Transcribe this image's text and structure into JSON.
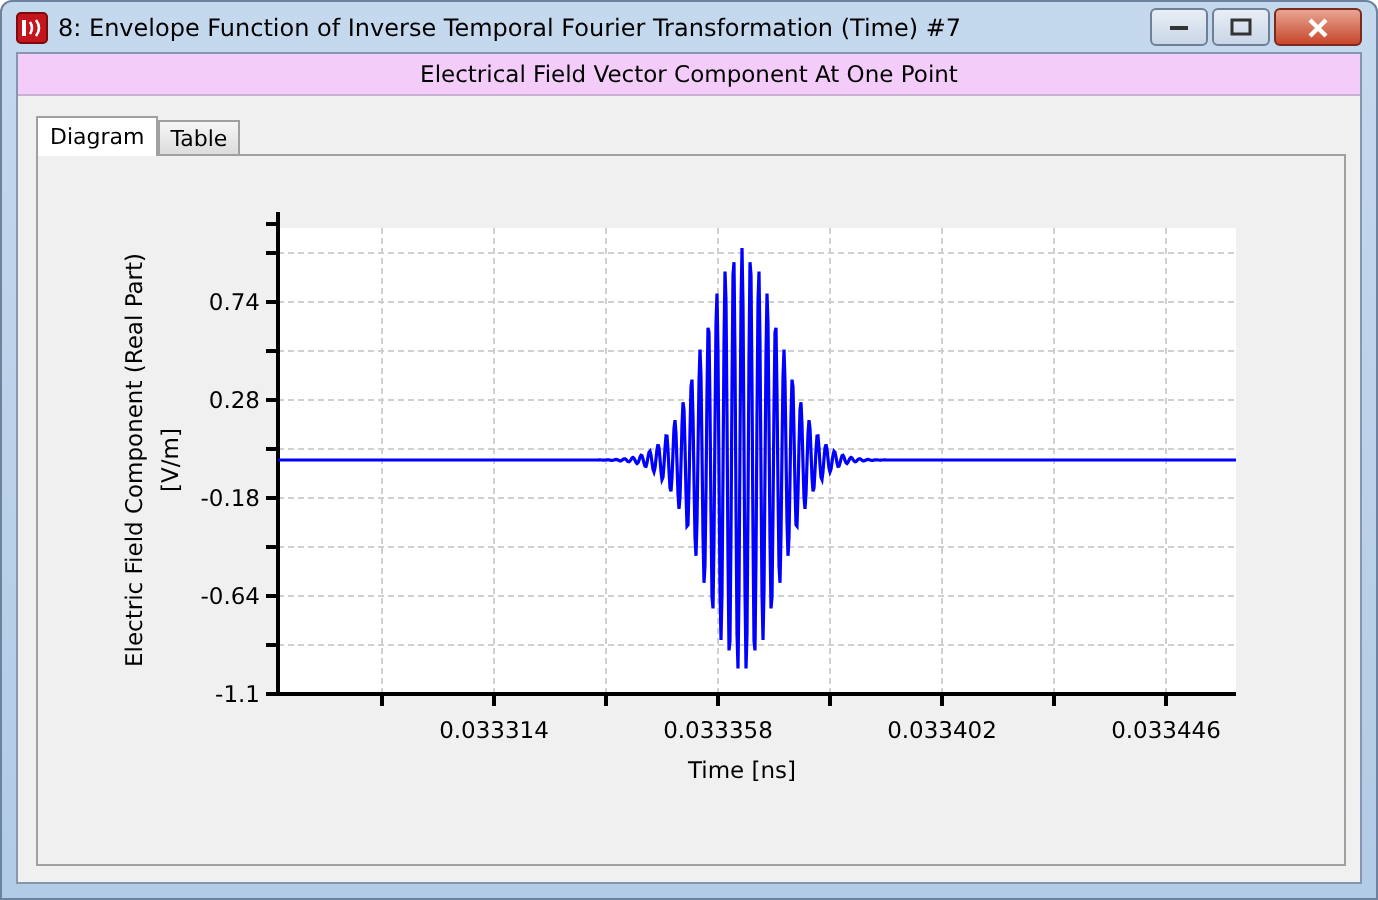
{
  "window": {
    "title": "8: Envelope Function of Inverse Temporal Fourier Transformation (Time) #7"
  },
  "header": {
    "text": "Electrical Field Vector Component At One Point"
  },
  "tabs": [
    {
      "label": "Diagram",
      "selected": true
    },
    {
      "label": "Table",
      "selected": false
    }
  ],
  "plot": {
    "ylabel_lines": [
      "Electric Field Component (Real Part)",
      "[V/m]"
    ],
    "yticks": [
      "0.74",
      "0.28",
      "-0.18",
      "-0.64",
      "-1.1"
    ],
    "xticks": [
      "0.033314",
      "0.033358",
      "0.033402",
      "0.033446"
    ],
    "xlabel": "Time [ns]"
  }
}
